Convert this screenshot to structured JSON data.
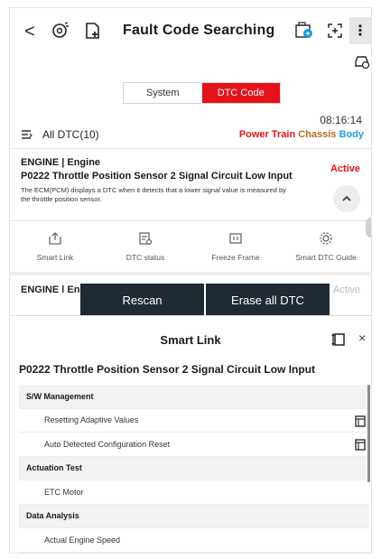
{
  "header": {
    "back": "<",
    "title": "Fault Code Searching",
    "more": "⋮",
    "icons": [
      "vehicle-scan-icon",
      "add-document-icon",
      "camera-share-icon",
      "capture-icon",
      "car-settings-icon"
    ]
  },
  "tabs": [
    {
      "label": "System",
      "active": false
    },
    {
      "label": "DTC Code",
      "active": true
    }
  ],
  "summary": {
    "time": "08:16:14",
    "all_dtc": "All DTC(10)",
    "categories": {
      "power_train": "Power Train",
      "chassis": "Chassis",
      "body": "Body"
    }
  },
  "dtc_card": {
    "system": "ENGINE | Engine",
    "code_title": "P0222 Throttle Position Sensor 2 Signal Circuit Low Input",
    "status": "Active",
    "description": "The ECM(PCM) displays a DTC when it detects that a lower signal value is measured by the throttle position sensor.",
    "actions": [
      {
        "label": "Smart Link",
        "icon": "share-icon"
      },
      {
        "label": "DTC status",
        "icon": "dtc-status-icon"
      },
      {
        "label": "Freeze Frame",
        "icon": "freeze-frame-icon"
      },
      {
        "label": "Smart DTC Guide",
        "icon": "gear-icon"
      }
    ]
  },
  "dtc_card2": {
    "system": "ENGINE | Engine",
    "status": "Active"
  },
  "floating_buttons": {
    "rescan": "Rescan",
    "erase_all": "Erase all DTC"
  },
  "smart_link": {
    "title": "Smart Link",
    "close": "×",
    "dtc": "P0222 Throttle Position Sensor 2 Signal Circuit Low Input",
    "rows": [
      {
        "type": "section",
        "label": "S/W Management"
      },
      {
        "type": "item",
        "label": "Resetting Adaptive Values",
        "doc": true
      },
      {
        "type": "item",
        "label": "Auto Detected Configuration Reset",
        "doc": true
      },
      {
        "type": "section",
        "label": "Actuation Test"
      },
      {
        "type": "item",
        "label": "ETC Motor",
        "doc": false
      },
      {
        "type": "section",
        "label": "Data Analysis"
      },
      {
        "type": "item",
        "label": "Actual Engine Speed",
        "doc": false
      }
    ]
  },
  "colors": {
    "accent": "#e5121a",
    "dark_button": "#1f2a33",
    "chassis": "#b86a20",
    "body": "#1e9ed8"
  }
}
